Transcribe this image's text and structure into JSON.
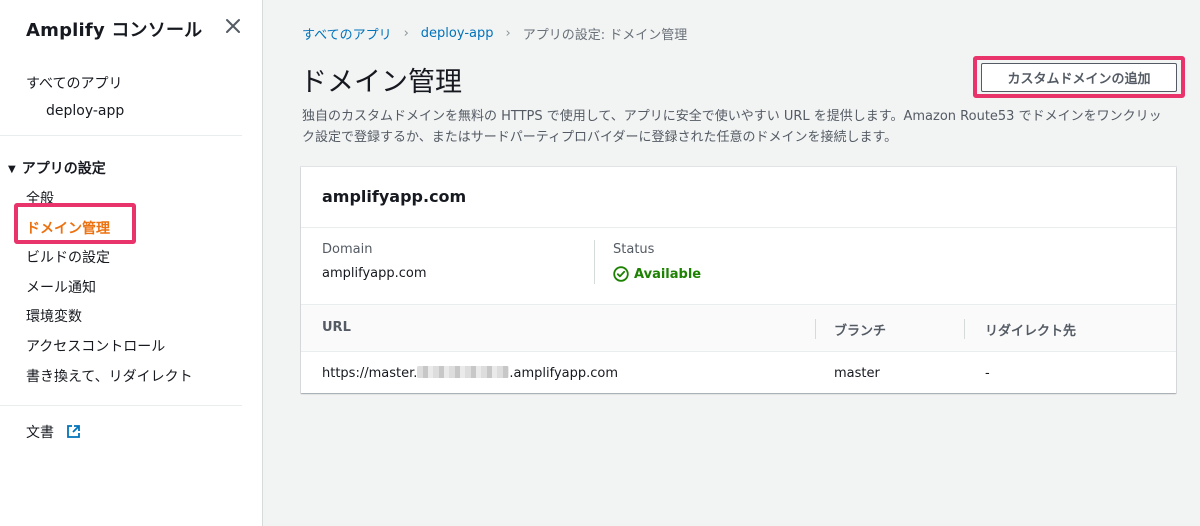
{
  "sidebar": {
    "title": "Amplify コンソール",
    "all_apps": "すべてのアプリ",
    "app_name": "deploy-app",
    "section": "アプリの設定",
    "items": [
      "全般",
      "ドメイン管理",
      "ビルドの設定",
      "メール通知",
      "環境変数",
      "アクセスコントロール",
      "書き換えて、リダイレクト"
    ],
    "active_index": 1,
    "docs": "文書"
  },
  "breadcrumb": {
    "root": "すべてのアプリ",
    "app": "deploy-app",
    "current": "アプリの設定: ドメイン管理"
  },
  "page": {
    "title": "ドメイン管理",
    "add_button": "カスタムドメインの追加",
    "description": "独自のカスタムドメインを無料の HTTPS で使用して、アプリに安全で使いやすい URL を提供します。Amazon Route53 でドメインをワンクリック設定で登録するか、またはサードパーティプロバイダーに登録された任意のドメインを接続します。"
  },
  "domain_card": {
    "title": "amplifyapp.com",
    "domain_label": "Domain",
    "domain_value": "amplifyapp.com",
    "status_label": "Status",
    "status_value": "Available",
    "table": {
      "headers": [
        "URL",
        "ブランチ",
        "リダイレクト先"
      ],
      "rows": [
        {
          "url_prefix": "https://master.",
          "url_suffix": ".amplifyapp.com",
          "branch": "master",
          "redirect": "-"
        }
      ]
    }
  },
  "colors": {
    "accent_orange": "#ec7211",
    "link_blue": "#0073bb",
    "success_green": "#1d8102",
    "highlight_pink": "#e8336b"
  }
}
